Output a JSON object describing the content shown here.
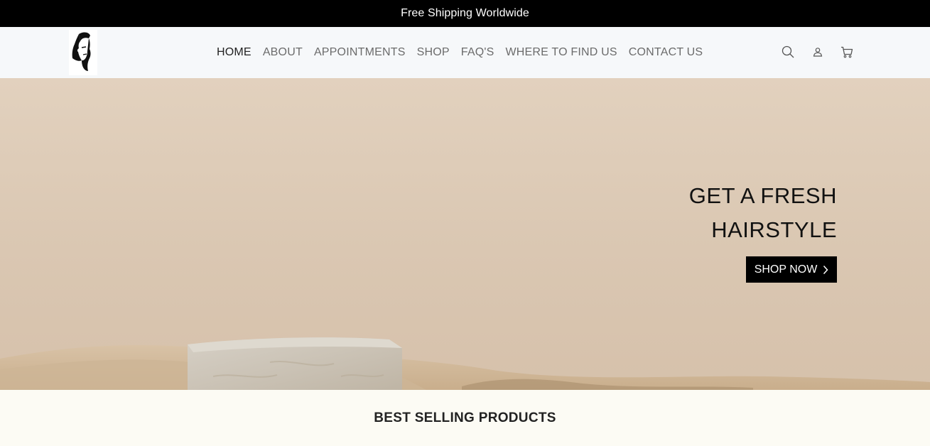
{
  "announcement": {
    "text": "Free Shipping Worldwide"
  },
  "header": {
    "logo": "barber-face-logo",
    "nav": [
      {
        "label": "HOME",
        "active": true
      },
      {
        "label": "ABOUT"
      },
      {
        "label": "APPOINTMENTS"
      },
      {
        "label": "SHOP"
      },
      {
        "label": "FAQ'S"
      },
      {
        "label": "WHERE TO FIND US"
      },
      {
        "label": "CONTACT US"
      }
    ],
    "icons": [
      "search-icon",
      "account-icon",
      "cart-icon"
    ]
  },
  "hero": {
    "headline_line1": "GET A FRESH",
    "headline_line2": "HAIRSTYLE",
    "cta_label": "SHOP NOW",
    "cta_icon": "chevron-right-icon"
  },
  "best_selling": {
    "title": "BEST SELLING PRODUCTS"
  },
  "colors": {
    "announcement_bg": "#000000",
    "header_bg": "#f6f8fa",
    "hero_bg": "#dccab6",
    "cta_bg": "#000000",
    "section_bg": "#fcfbf4"
  }
}
